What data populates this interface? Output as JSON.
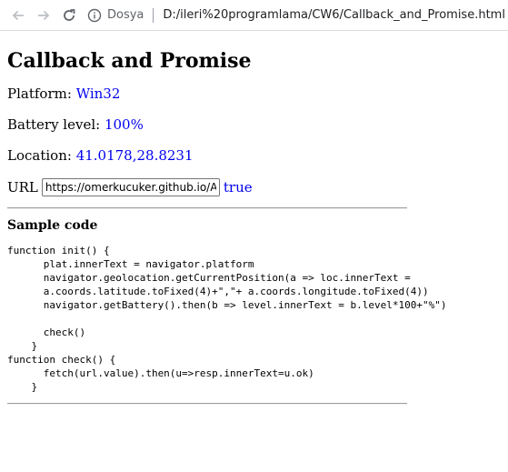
{
  "browser": {
    "address_label": "Dosya",
    "address_url": "D:/ileri%20programlama/CW6/Callback_and_Promise.html"
  },
  "page": {
    "title": "Callback and Promise",
    "platform_label": "Platform:",
    "platform_value": "Win32",
    "battery_label": "Battery level:",
    "battery_value": "100%",
    "location_label": "Location:",
    "location_value": "41.0178,28.8231",
    "url_label": "URL",
    "url_input_value": "https://omerkucuker.github.io/Ad",
    "response_value": "true",
    "sample_heading": "Sample code",
    "sample_code": "function init() {\n      plat.innerText = navigator.platform\n      navigator.geolocation.getCurrentPosition(a => loc.innerText =\n      a.coords.latitude.toFixed(4)+\",\"+ a.coords.longitude.toFixed(4))\n      navigator.getBattery().then(b => level.innerText = b.level*100+\"%\")\n\n      check()\n    }\nfunction check() {\n      fetch(url.value).then(u=>resp.innerText=u.ok)\n    }"
  }
}
